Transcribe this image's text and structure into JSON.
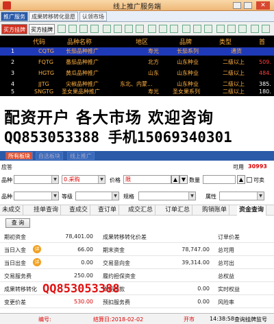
{
  "window": {
    "title": "线上推广服务端"
  },
  "top_tabs": [
    "推广服务",
    "成果转移转化意愿",
    "认领市场"
  ],
  "toolbar": {
    "buy_label": "买方挂牌",
    "sell_label": "买方挂牌"
  },
  "grid": {
    "headers": [
      "代码",
      "品种名称",
      "地区",
      "品牌",
      "类型",
      "首"
    ],
    "rows": [
      {
        "idx": "1",
        "code": "CQTG",
        "name": "长茄品种推广",
        "region": "寿光",
        "brand": "长茄系列",
        "type": "通货",
        "first": ""
      },
      {
        "idx": "2",
        "code": "FQTG",
        "name": "番茄品种推广",
        "region": "北方",
        "brand": "山东种业",
        "type": "二级以上",
        "first": "509."
      },
      {
        "idx": "3",
        "code": "HGTG",
        "name": "黄瓜品种推广",
        "region": "山东",
        "brand": "山东种业",
        "type": "二级以上",
        "first": "484."
      },
      {
        "idx": "4",
        "code": "JJTG",
        "name": "尖椒品种推广",
        "region": "东北、内蒙...",
        "brand": "山东种业",
        "type": "二级以上",
        "first": "385."
      },
      {
        "idx": "5",
        "code": "SNGTG",
        "name": "圣女果品种推广",
        "region": "寿光",
        "brand": "圣女果系列",
        "type": "二级以上",
        "first": "180."
      }
    ]
  },
  "banner": {
    "line1": "配资开户  各大市场  欢迎咨询",
    "line2": "QQ853053388  手机15069340301"
  },
  "bottom_tabs": [
    "所有板块",
    "自选板块",
    "线上推广"
  ],
  "info": {
    "left": "应答",
    "avail_label": "可用",
    "avail_value": "30993",
    "sell_label": "可卖"
  },
  "form": {
    "variety_label": "品种",
    "direction_value": "0.采购",
    "price_label": "价格",
    "price_value": "限",
    "qty_label": "数量",
    "sellable_label": "可下单",
    "variety2_label": "品种",
    "grade_label": "等级",
    "spec_label": "规格",
    "attr_label": "属性"
  },
  "subtabs": [
    "未成交",
    "挂单查询",
    "查成交",
    "查订单",
    "成交汇总",
    "订单汇总",
    "购销账单",
    "资金查询"
  ],
  "query_label": "查 询",
  "funds": [
    {
      "l1": "期初资金",
      "v1": "78,401.00",
      "l2": "成果转移转化价差",
      "v2": "",
      "l3": "订单价差",
      "badge": ""
    },
    {
      "l1": "当日入金",
      "v1": "66.00",
      "l2": "期末资金",
      "v2": "78,747.00",
      "l3": "总可用",
      "badge": "详"
    },
    {
      "l1": "当日出金",
      "v1": "0.00",
      "l2": "交易意向金",
      "v2": "39,314.00",
      "l3": "总可出",
      "badge": "详"
    },
    {
      "l1": "交易服务费",
      "v1": "250.00",
      "l2": "履约担保资金",
      "v2": "",
      "l3": "总权益",
      "badge": ""
    },
    {
      "l1": "成果转移转化",
      "v1": "",
      "l2": "本期货款",
      "v2": "0.00",
      "l3": "实时权益",
      "badge": ""
    },
    {
      "l1": "变更价差",
      "v1": "530.00",
      "l2": "预扣服务费",
      "v2": "0.00",
      "l3": "风险率",
      "badge": ""
    }
  ],
  "watermark": "QQ853053388",
  "status": {
    "id_label": "编号:",
    "date_label": "结算日:2018-02-02",
    "state": "开市",
    "time": "14:38:58",
    "hint": "查询挂牌监号"
  }
}
